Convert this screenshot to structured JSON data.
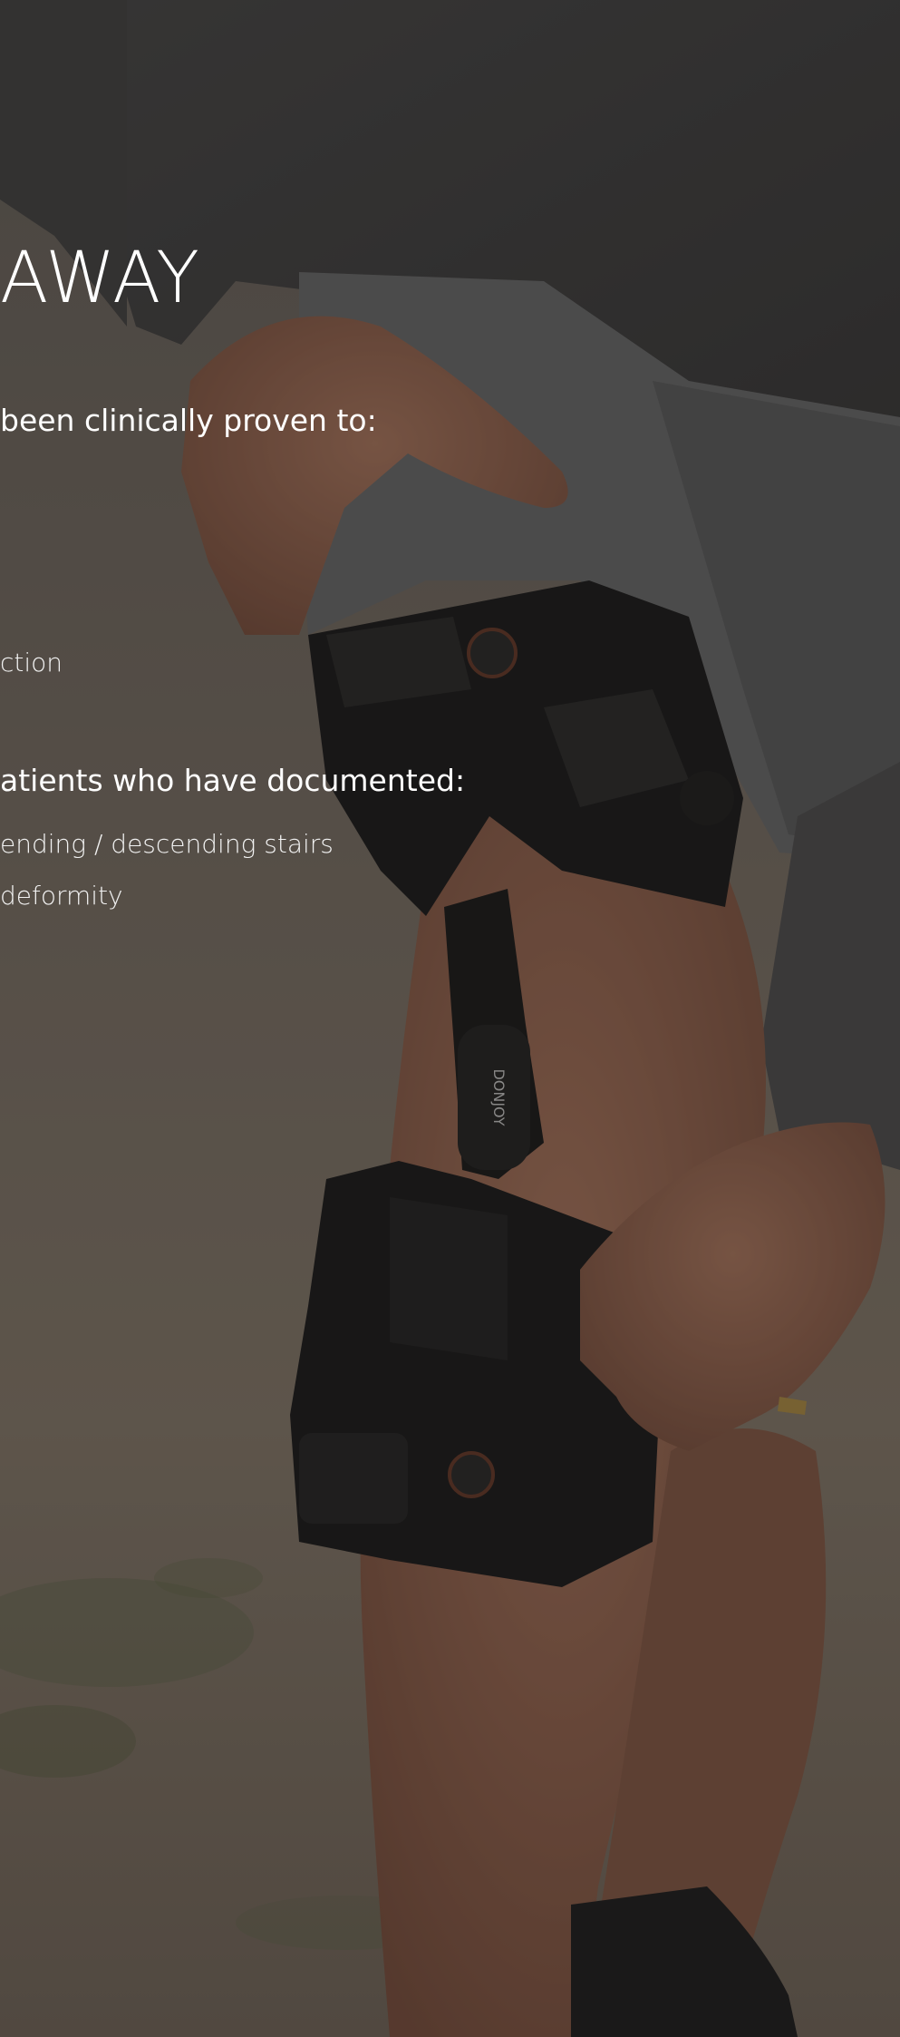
{
  "hero": {
    "headline": "AWAY",
    "section_1": {
      "intro": "been clinically proven to:",
      "items": [
        "ction"
      ]
    },
    "section_2": {
      "intro": "atients who have documented:",
      "items": [
        "ending / descending stairs",
        "deformity"
      ]
    },
    "brace_brand_text": "DONJOY"
  },
  "colors": {
    "text": "#ffffff",
    "overlay": "rgba(20,18,16,0.38)",
    "background": "#4a4540"
  }
}
